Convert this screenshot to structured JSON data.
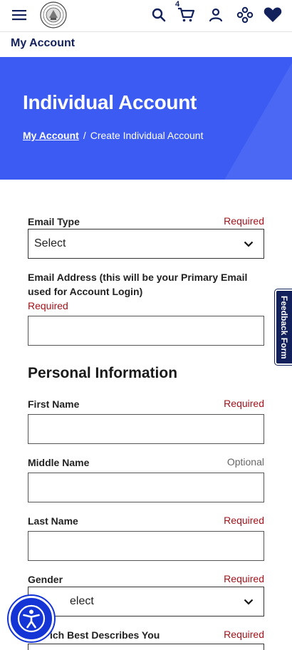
{
  "header": {
    "cart_count": "4",
    "icons": [
      "menu-icon",
      "seal-logo",
      "search-icon",
      "cart-icon",
      "account-icon",
      "sitemap-icon",
      "heart-icon"
    ]
  },
  "account_bar": {
    "label": "My Account"
  },
  "hero": {
    "title": "Individual Account",
    "breadcrumb": {
      "link": "My Account",
      "separator": "/",
      "current": "Create Individual Account"
    }
  },
  "form": {
    "email_type": {
      "label": "Email Type",
      "status": "Required",
      "value": "Select"
    },
    "email_address": {
      "label_line1": "Email Address (this will be your Primary Email",
      "label_line2": "used for Account Login)",
      "status": "Required",
      "value": ""
    },
    "section_title": "Personal Information",
    "first_name": {
      "label": "First Name",
      "status": "Required",
      "value": ""
    },
    "middle_name": {
      "label": "Middle Name",
      "status": "Optional",
      "value": ""
    },
    "last_name": {
      "label": "Last Name",
      "status": "Required",
      "value": ""
    },
    "gender": {
      "label": "Gender",
      "status": "Required",
      "value": "elect"
    },
    "describes": {
      "label": "ich Best Describes You",
      "status": "Required"
    }
  },
  "feedback": {
    "label": "Feedback Form"
  },
  "colors": {
    "brand": "#12215b",
    "hero": "#3b5bf2",
    "required": "#a1121b",
    "a11y": "#1434d6"
  }
}
